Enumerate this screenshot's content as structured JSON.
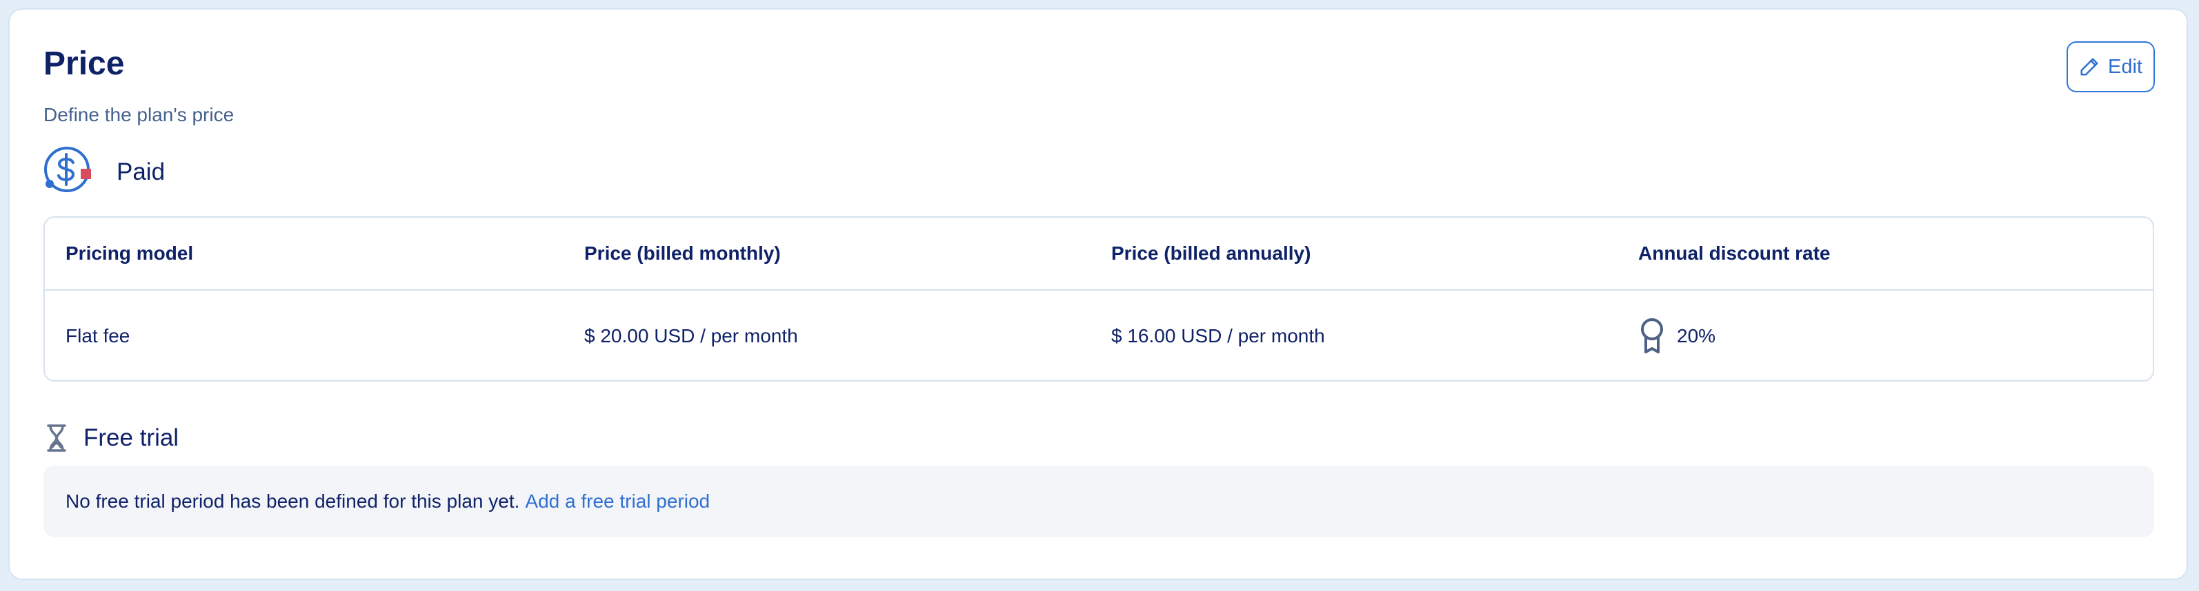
{
  "section": {
    "title": "Price",
    "subtitle": "Define the plan's price",
    "edit_label": "Edit"
  },
  "paid": {
    "label": "Paid",
    "icon": "dollar-circle-icon"
  },
  "table": {
    "headers": [
      "Pricing model",
      "Price (billed monthly)",
      "Price (billed annually)",
      "Annual discount rate"
    ],
    "rows": [
      {
        "pricing_model": "Flat fee",
        "monthly_price": "$ 20.00 USD / per month",
        "annual_price": "$ 16.00 USD / per month",
        "discount_rate": "20%"
      }
    ]
  },
  "free_trial": {
    "label": "Free trial",
    "icon": "hourglass-icon",
    "message": "No free trial period has been defined for this plan yet.",
    "link_label": "Add a free trial period"
  },
  "colors": {
    "accent": "#2f6fcf",
    "text": "#0f2268",
    "muted_text": "#45618f",
    "background": "#e4eef9",
    "card_background": "#ffffff",
    "info_box": "#f3f5f8"
  }
}
